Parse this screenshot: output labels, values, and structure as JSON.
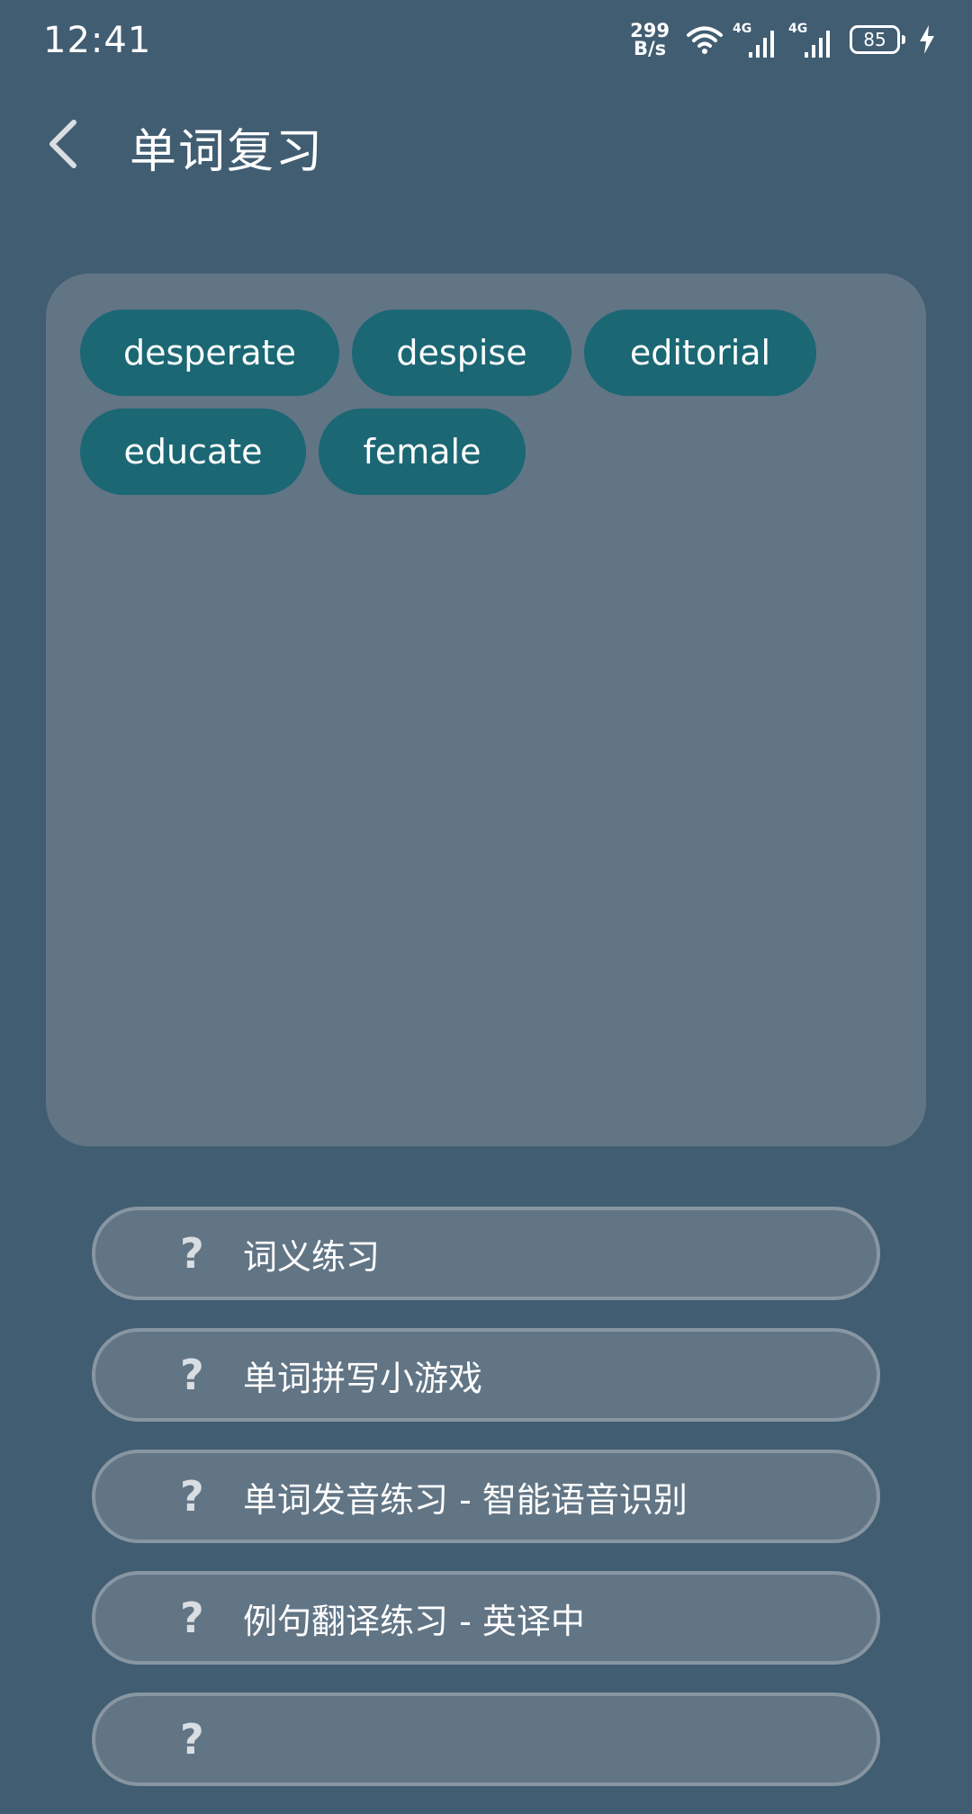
{
  "status_bar": {
    "time": "12:41",
    "net_speed_value": "299",
    "net_speed_unit": "B/s",
    "sim1_label": "4G",
    "sim2_label": "4G",
    "battery": "85"
  },
  "header": {
    "title": "单词复习"
  },
  "word_chips": {
    "row1": [
      "desperate",
      "despise",
      "editorial"
    ],
    "row2": [
      "educate",
      "female"
    ]
  },
  "practice": {
    "items": [
      {
        "icon": "?",
        "label": "词义练习"
      },
      {
        "icon": "?",
        "label": "单词拼写小游戏"
      },
      {
        "icon": "?",
        "label": "单词发音练习 - 智能语音识别"
      },
      {
        "icon": "?",
        "label": "例句翻译练习 - 英译中"
      },
      {
        "icon": "?",
        "label": ""
      }
    ]
  }
}
